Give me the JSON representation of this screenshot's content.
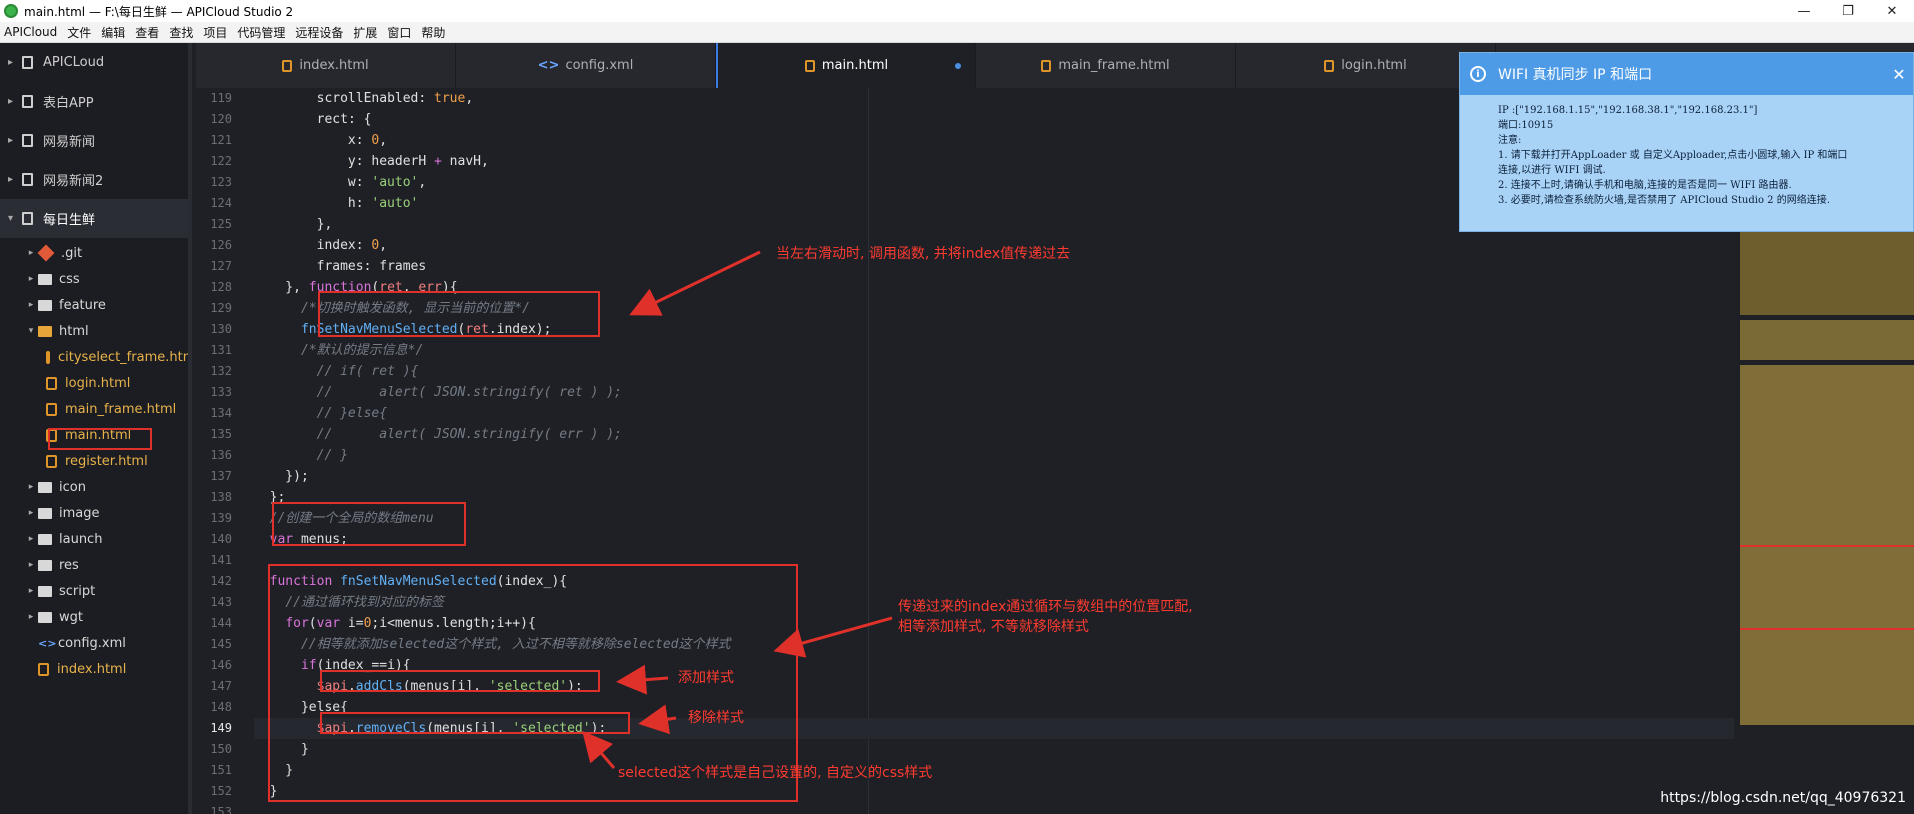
{
  "window": {
    "title": "main.html — F:\\每日生鲜 — APICloud Studio 2",
    "min_glyph": "—",
    "max_glyph": "❐",
    "close_glyph": "✕"
  },
  "menu": [
    "APICloud",
    "文件",
    "编辑",
    "查看",
    "查找",
    "项目",
    "代码管理",
    "远程设备",
    "扩展",
    "窗口",
    "帮助"
  ],
  "sidebar": {
    "projects": [
      "APICLoud",
      "表白APP",
      "网易新闻",
      "网易新闻2",
      "每日生鲜"
    ],
    "tree": [
      {
        "name": ".git",
        "kind": "git",
        "indent": 1,
        "arrow": "▸"
      },
      {
        "name": "css",
        "kind": "folder",
        "indent": 1,
        "arrow": "▸"
      },
      {
        "name": "feature",
        "kind": "folder",
        "indent": 1,
        "arrow": "▸"
      },
      {
        "name": "html",
        "kind": "folder-open",
        "indent": 1,
        "arrow": "▾"
      },
      {
        "name": "cityselect_frame.html",
        "kind": "file",
        "indent": 2,
        "arrow": ""
      },
      {
        "name": "login.html",
        "kind": "file",
        "indent": 2,
        "arrow": ""
      },
      {
        "name": "main_frame.html",
        "kind": "file",
        "indent": 2,
        "arrow": ""
      },
      {
        "name": "main.html",
        "kind": "file",
        "indent": 2,
        "arrow": ""
      },
      {
        "name": "register.html",
        "kind": "file",
        "indent": 2,
        "arrow": ""
      },
      {
        "name": "icon",
        "kind": "folder",
        "indent": 1,
        "arrow": "▸"
      },
      {
        "name": "image",
        "kind": "folder",
        "indent": 1,
        "arrow": "▸"
      },
      {
        "name": "launch",
        "kind": "folder",
        "indent": 1,
        "arrow": "▸"
      },
      {
        "name": "res",
        "kind": "folder",
        "indent": 1,
        "arrow": "▸"
      },
      {
        "name": "script",
        "kind": "folder",
        "indent": 1,
        "arrow": "▸"
      },
      {
        "name": "wgt",
        "kind": "folder",
        "indent": 1,
        "arrow": "▸"
      },
      {
        "name": "config.xml",
        "kind": "xml",
        "indent": 1,
        "arrow": ""
      },
      {
        "name": "index.html",
        "kind": "file",
        "indent": 1,
        "arrow": ""
      }
    ]
  },
  "tabs": [
    {
      "label": "index.html",
      "icon": "html-file-icon"
    },
    {
      "label": "config.xml",
      "icon": "xml-file-icon"
    },
    {
      "label": "main.html",
      "icon": "html-file-icon",
      "active": true
    },
    {
      "label": "main_frame.html",
      "icon": "html-file-icon"
    },
    {
      "label": "login.html",
      "icon": "html-file-icon"
    }
  ],
  "editor": {
    "first_line": 119,
    "current_line": 149,
    "lines": [
      [
        [
          "        ",
          ""
        ],
        [
          "scrollEnabled",
          "pr"
        ],
        [
          ": ",
          ""
        ],
        [
          "true",
          "bool"
        ],
        [
          ",",
          ""
        ]
      ],
      [
        [
          "        ",
          ""
        ],
        [
          "rect",
          "pr"
        ],
        [
          ": {",
          ""
        ]
      ],
      [
        [
          "            ",
          ""
        ],
        [
          "x",
          "pr"
        ],
        [
          ": ",
          ""
        ],
        [
          "0",
          "num"
        ],
        [
          ",",
          ""
        ]
      ],
      [
        [
          "            ",
          ""
        ],
        [
          "y",
          "pr"
        ],
        [
          ": headerH ",
          ""
        ],
        [
          "+",
          "kw"
        ],
        [
          " navH,",
          ""
        ]
      ],
      [
        [
          "            ",
          ""
        ],
        [
          "w",
          "pr"
        ],
        [
          ": ",
          ""
        ],
        [
          "'auto'",
          "str"
        ],
        [
          ",",
          ""
        ]
      ],
      [
        [
          "            ",
          ""
        ],
        [
          "h",
          "pr"
        ],
        [
          ": ",
          ""
        ],
        [
          "'auto'",
          "str"
        ],
        [
          "",
          ""
        ]
      ],
      [
        [
          "        },",
          ""
        ]
      ],
      [
        [
          "        ",
          ""
        ],
        [
          "index",
          "pr"
        ],
        [
          ": ",
          ""
        ],
        [
          "0",
          "num"
        ],
        [
          ",",
          ""
        ]
      ],
      [
        [
          "        ",
          ""
        ],
        [
          "frames",
          "pr"
        ],
        [
          ": frames",
          ""
        ]
      ],
      [
        [
          "    }, ",
          ""
        ],
        [
          "function",
          "kw"
        ],
        [
          "(",
          ""
        ],
        [
          "ret",
          "va"
        ],
        [
          ", ",
          ""
        ],
        [
          "err",
          "va"
        ],
        [
          "){",
          ""
        ]
      ],
      [
        [
          "      ",
          ""
        ],
        [
          "/*切换时触发函数, 显示当前的位置*/",
          "cm"
        ]
      ],
      [
        [
          "      ",
          ""
        ],
        [
          "fnSetNavMenuSelected",
          "fn"
        ],
        [
          "(",
          ""
        ],
        [
          "ret",
          "va"
        ],
        [
          ".",
          ""
        ],
        [
          "index",
          "pr"
        ],
        [
          ");",
          ""
        ]
      ],
      [
        [
          "      ",
          ""
        ],
        [
          "/*默认的提示信息*/",
          "cm"
        ]
      ],
      [
        [
          "        ",
          ""
        ],
        [
          "// if( ret ){",
          "cm"
        ]
      ],
      [
        [
          "        ",
          ""
        ],
        [
          "//      alert( JSON.stringify( ret ) );",
          "cm"
        ]
      ],
      [
        [
          "        ",
          ""
        ],
        [
          "// }else{",
          "cm"
        ]
      ],
      [
        [
          "        ",
          ""
        ],
        [
          "//      alert( JSON.stringify( err ) );",
          "cm"
        ]
      ],
      [
        [
          "        ",
          ""
        ],
        [
          "// }",
          "cm"
        ]
      ],
      [
        [
          "    });",
          ""
        ]
      ],
      [
        [
          "  };",
          ""
        ]
      ],
      [
        [
          "  ",
          ""
        ],
        [
          "//创建一个全局的数组menu",
          "cm"
        ]
      ],
      [
        [
          "  ",
          ""
        ],
        [
          "var",
          "kw"
        ],
        [
          " menus;",
          ""
        ]
      ],
      [
        [
          "",
          ""
        ]
      ],
      [
        [
          "  ",
          ""
        ],
        [
          "function",
          "kw"
        ],
        [
          " ",
          ""
        ],
        [
          "fnSetNavMenuSelected",
          "fn"
        ],
        [
          "(index_){",
          ""
        ]
      ],
      [
        [
          "    ",
          ""
        ],
        [
          "//通过循环找到对应的标签",
          "cm"
        ]
      ],
      [
        [
          "    ",
          ""
        ],
        [
          "for",
          "kw"
        ],
        [
          "(",
          ""
        ],
        [
          "var",
          "kw"
        ],
        [
          " i=",
          ""
        ],
        [
          "0",
          "num"
        ],
        [
          ";i<menus.",
          ""
        ],
        [
          "length",
          "pr"
        ],
        [
          ";i++){",
          ""
        ]
      ],
      [
        [
          "      ",
          ""
        ],
        [
          "//相等就添加selected这个样式, 入过不相等就移除selected这个样式",
          "cm"
        ]
      ],
      [
        [
          "      ",
          ""
        ],
        [
          "if",
          "kw"
        ],
        [
          "(index_==i){",
          ""
        ]
      ],
      [
        [
          "        ",
          ""
        ],
        [
          "$api",
          "va"
        ],
        [
          ".",
          ""
        ],
        [
          "addCls",
          "fn"
        ],
        [
          "(menus[i], ",
          ""
        ],
        [
          "'selected'",
          "str"
        ],
        [
          ");",
          ""
        ]
      ],
      [
        [
          "      }else{",
          ""
        ]
      ],
      [
        [
          "        ",
          ""
        ],
        [
          "$api",
          "va"
        ],
        [
          ".",
          ""
        ],
        [
          "removeCls",
          "fn"
        ],
        [
          "(menus[i], ",
          ""
        ],
        [
          "'selected'",
          "str"
        ],
        [
          ");",
          ""
        ]
      ],
      [
        [
          "      }",
          ""
        ]
      ],
      [
        [
          "    }",
          ""
        ]
      ],
      [
        [
          "  }",
          ""
        ]
      ],
      [
        [
          "",
          ""
        ]
      ]
    ]
  },
  "annotations": {
    "a1": "当左右滑动时, 调用函数, 并将index值传递过去",
    "a2_line1": "传递过来的index通过循环与数组中的位置匹配,",
    "a2_line2": "相等添加样式, 不等就移除样式",
    "a3": "添加样式",
    "a4": "移除样式",
    "a5": "selected这个样式是自己设置的, 自定义的css样式"
  },
  "notification": {
    "title": "WIFI 真机同步 IP 和端口",
    "lines": [
      "IP  :[\"192.168.1.15\",\"192.168.38.1\",\"192.168.23.1\"]",
      "端口:10915",
      "注意:",
      "1. 请下载并打开AppLoader 或 自定义Apploader,点击小圆球,输入 IP 和端口",
      "连接,以进行 WIFI 调试.",
      "2. 连接不上时,请确认手机和电脑,连接的是否是同一 WIFI 路由器.",
      "3. 必要时,请检查系统防火墙,是否禁用了 APICloud Studio 2 的网络连接."
    ]
  },
  "watermark": "https://blog.csdn.net/qq_40976321",
  "colors": {
    "accent": "#4d9be6",
    "annotation": "#e0302a"
  }
}
